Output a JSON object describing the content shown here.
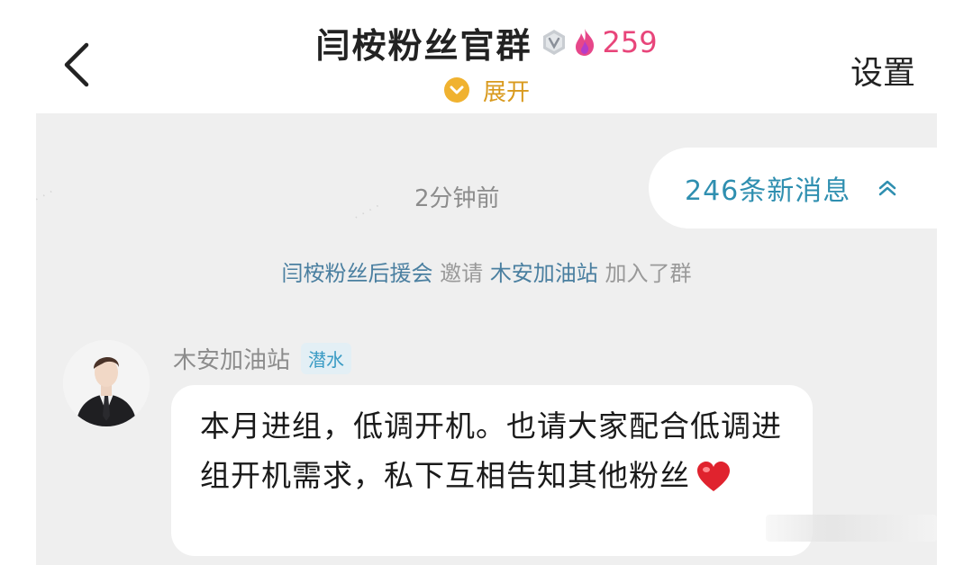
{
  "header": {
    "title": "闫桉粉丝官群",
    "hot_count": "259",
    "expand_label": "展开",
    "settings_label": "设置"
  },
  "chat": {
    "timestamp": "2分钟前",
    "new_messages": {
      "label": "246条新消息"
    },
    "system_notice": {
      "inviter": "闫桉粉丝后援会",
      "action": " 邀请 ",
      "invitee": "木安加油站",
      "suffix": " 加入了群"
    },
    "message": {
      "sender": "木安加油站",
      "role": "潜水",
      "text": "本月进组，低调开机。也请大家配合低调进组开机需求，私下互相告知其他粉丝"
    }
  },
  "colors": {
    "hot": "#e8457a",
    "expand": "#d99a1e",
    "link": "#2f8fb0",
    "chat_bg": "#efefef"
  },
  "icons": [
    "back-arrow-icon",
    "verified-badge-icon",
    "fire-icon",
    "chevron-down-icon",
    "chevron-up-icon",
    "heart-icon"
  ]
}
